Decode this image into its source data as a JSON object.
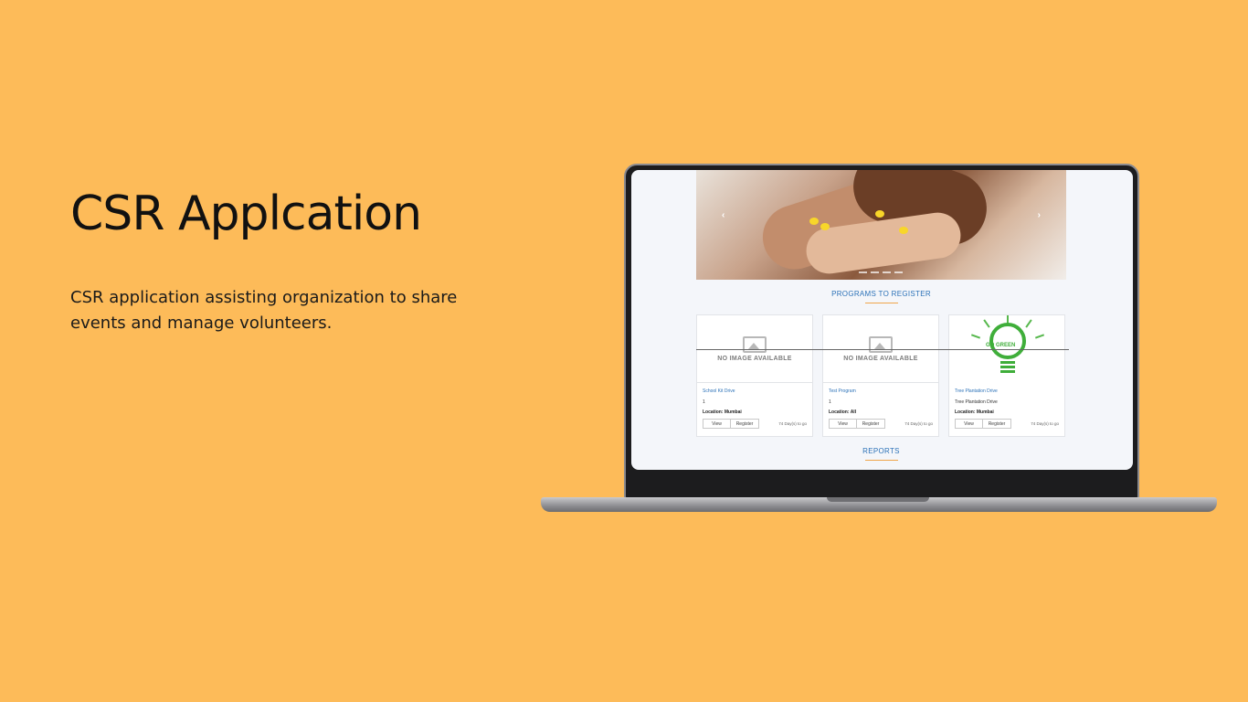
{
  "hero": {
    "title": "CSR Applcation",
    "description": "CSR application assisting organization to share events and manage volunteers."
  },
  "app": {
    "carousel": {
      "prev_icon": "chevron-left-icon",
      "next_icon": "chevron-right-icon"
    },
    "programs_heading": "PROGRAMS TO REGISTER",
    "reports_heading": "REPORTS",
    "no_image_text": "NO IMAGE AVAILABLE",
    "cards": [
      {
        "title": "School Kit Drive",
        "description": "1",
        "location": "Location: Mumbai",
        "view": "View",
        "register": "Register",
        "days": "74 Day(s) to go"
      },
      {
        "title": "Test Program",
        "description": "1",
        "location": "Location: All",
        "view": "View",
        "register": "Register",
        "days": "74 Day(s) to go"
      },
      {
        "title": "Tree Plantation Drive",
        "description": "Tree Plantation Drive",
        "location": "Location: Mumbai",
        "view": "View",
        "register": "Register",
        "days": "74 Day(s) to go",
        "image_label": "GO GREEN"
      }
    ],
    "colors": {
      "accent": "#2c72b8",
      "underline": "#f0a54b",
      "background": "#fdbb59"
    }
  }
}
